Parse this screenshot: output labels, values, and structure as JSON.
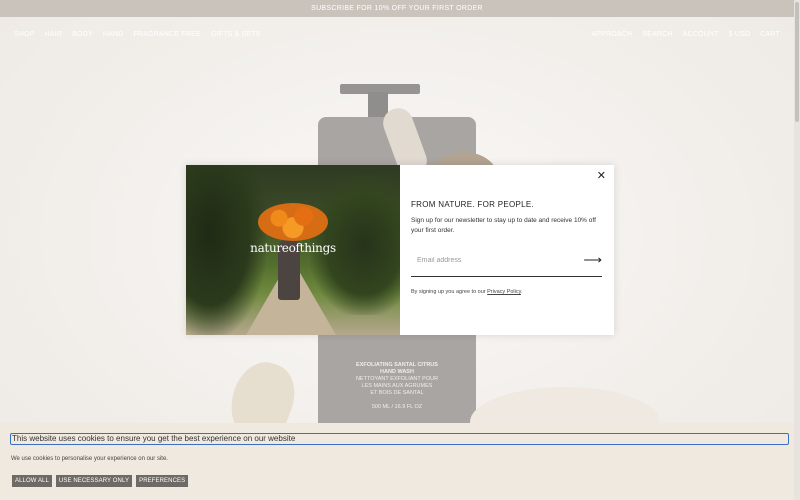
{
  "announcement": "SUBSCRIBE FOR 10% OFF YOUR FIRST ORDER",
  "nav": {
    "left": [
      "SHOP",
      "HAIR",
      "BODY",
      "HAND",
      "FRAGRANCE FREE",
      "GIFTS & SETS"
    ],
    "right": [
      "APPROACH",
      "SEARCH",
      "ACCOUNT",
      "$ USD",
      "CART"
    ]
  },
  "product": {
    "label_line1": "EXFOLIATING SANTAL CITRUS",
    "label_line2": "HAND WASH",
    "label_line3": "NETTOYANT EXFOLIANT POUR",
    "label_line4": "LES MAINS AUX AGRUMES",
    "label_line5": "ET BOIS DE SANTAL",
    "volume": "500 ML / 16.9 FL OZ"
  },
  "modal": {
    "brand": "natureofthings",
    "title": "FROM NATURE. FOR PEOPLE.",
    "text": "Sign up for our newsletter to stay up to date and receive 10% off your first order.",
    "email_placeholder": "Email address",
    "privacy_prefix": "By signing up you agree to our ",
    "privacy_link": "Privacy Policy",
    "privacy_suffix": ".",
    "close_glyph": "✕",
    "submit_glyph": "⟶"
  },
  "cookie": {
    "title": "This website uses cookies to ensure you get the best experience on our website",
    "description": "We use cookies to personalise your experience on our site.",
    "buttons": {
      "allow_all": "ALLOW ALL",
      "necessary": "USE NECESSARY ONLY",
      "preferences": "PREFERENCES"
    }
  }
}
